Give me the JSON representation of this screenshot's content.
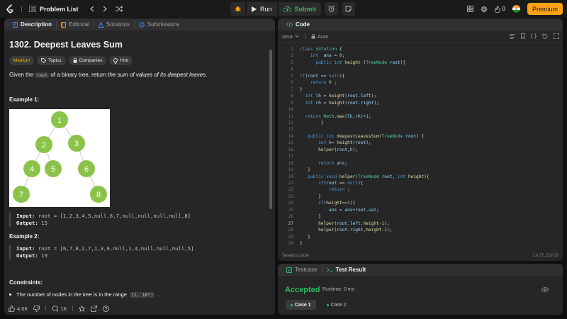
{
  "topbar": {
    "problem_list": "Problem List",
    "run": "Run",
    "submit": "Submit",
    "streak": "0",
    "premium": "Premium"
  },
  "left_tabs": [
    {
      "label": "Description"
    },
    {
      "label": "Editorial"
    },
    {
      "label": "Solutions"
    },
    {
      "label": "Submissions"
    }
  ],
  "problem": {
    "title": "1302. Deepest Leaves Sum",
    "difficulty": "Medium",
    "badges": [
      "Topics",
      "Companies",
      "Hint"
    ],
    "desc_before": "Given the ",
    "desc_code": "root",
    "desc_mid": " of a binary tree, return ",
    "desc_em": "the sum of values of its deepest leaves",
    "desc_end": ".",
    "example1_title": "Example 1:",
    "example1_input_label": "Input:",
    "example1_input": "root = [1,2,3,4,5,null,6,7,null,null,null,null,8]",
    "example1_output_label": "Output:",
    "example1_output": "15",
    "example2_title": "Example 2:",
    "example2_input_label": "Input:",
    "example2_input": "root = [6,7,8,2,7,1,3,9,null,1,4,null,null,null,5]",
    "example2_output_label": "Output:",
    "example2_output": "19",
    "constraints_title": "Constraints:",
    "constraint1_text": "The number of nodes in the tree is in the range ",
    "constraint1_code": "[1, 10⁴]",
    "constraint1_end": ".",
    "tree_nodes": [
      "1",
      "2",
      "3",
      "4",
      "5",
      "6",
      "7",
      "8"
    ]
  },
  "left_footer": {
    "likes": "4.6K",
    "comments": "16"
  },
  "code": {
    "tab": "Code",
    "language": "Java",
    "mode": "Auto",
    "lines": [
      "class Solution {",
      "    int  ans = 0;",
      "      public int height (TreeNode root){",
      "",
      "if(root == null){",
      "    return 0 ;",
      "}",
      "  int lh = height(root.left);",
      "  int rh = height(root.right);",
      "",
      "  return Math.max(lh,rh)+1;",
      "        }",
      "",
      "   public int deepestLeavesSum(TreeNode root) {",
      "       int h= height(root);",
      "       helper(root,h);",
      "",
      "       return ans;",
      "   }",
      "   public void helper(TreeNode root, int height){",
      "       if(root == null){",
      "           return ;",
      "       }",
      "       if(height==1){",
      "           ans = ans+root.val;",
      "       }",
      "       helper(root.left,height-1);",
      "       helper(root.right,height-1);",
      "   }",
      "}"
    ],
    "saved": "Saved to local",
    "position": "Ln 27, Col 20"
  },
  "result": {
    "testcase_tab": "Testcase",
    "result_tab": "Test Result",
    "status": "Accepted",
    "runtime": "Runtime: 0 ms",
    "cases": [
      "Case 1",
      "Case 2"
    ]
  },
  "colors": {
    "accent": "#ffa116",
    "accepted": "#2cbb5d",
    "medium": "#ffb800",
    "node": "#8bc34a"
  }
}
